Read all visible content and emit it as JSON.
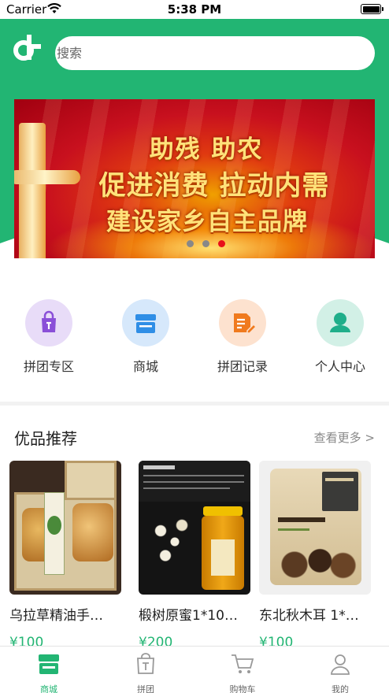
{
  "status_bar": {
    "carrier": "Carrier",
    "time": "5:38 PM"
  },
  "search": {
    "placeholder": "搜索"
  },
  "banner": {
    "line1": "助残  助农",
    "line2": "促进消费   拉动内需",
    "line3": "建设家乡自主品牌",
    "active_slide": 3,
    "slide_count": 3
  },
  "menu": {
    "items": [
      {
        "label": "拼团专区",
        "icon": "shopping-bag-icon",
        "bg": "#e8dcf8",
        "fg": "#8a4fd8"
      },
      {
        "label": "商城",
        "icon": "store-icon",
        "bg": "#d6e8fb",
        "fg": "#2f8ee6"
      },
      {
        "label": "拼团记录",
        "icon": "document-edit-icon",
        "bg": "#fde2cf",
        "fg": "#f07a1e"
      },
      {
        "label": "个人中心",
        "icon": "user-icon",
        "bg": "#d2f0e6",
        "fg": "#1fae8a"
      }
    ]
  },
  "recommend": {
    "title": "优品推荐",
    "more": "查看更多 >",
    "products": [
      {
        "name": "乌拉草精油手…",
        "price": "¥100"
      },
      {
        "name": "椴树原蜜1*10…",
        "price": "¥200"
      },
      {
        "name": "东北秋木耳 1*…",
        "price": "¥100"
      }
    ]
  },
  "tabbar": {
    "tabs": [
      {
        "label": "商城",
        "active": true
      },
      {
        "label": "拼团",
        "active": false
      },
      {
        "label": "购物车",
        "active": false
      },
      {
        "label": "我的",
        "active": false
      }
    ]
  },
  "colors": {
    "brand": "#22b573",
    "banner_red": "#c8101e",
    "price": "#22b573"
  }
}
